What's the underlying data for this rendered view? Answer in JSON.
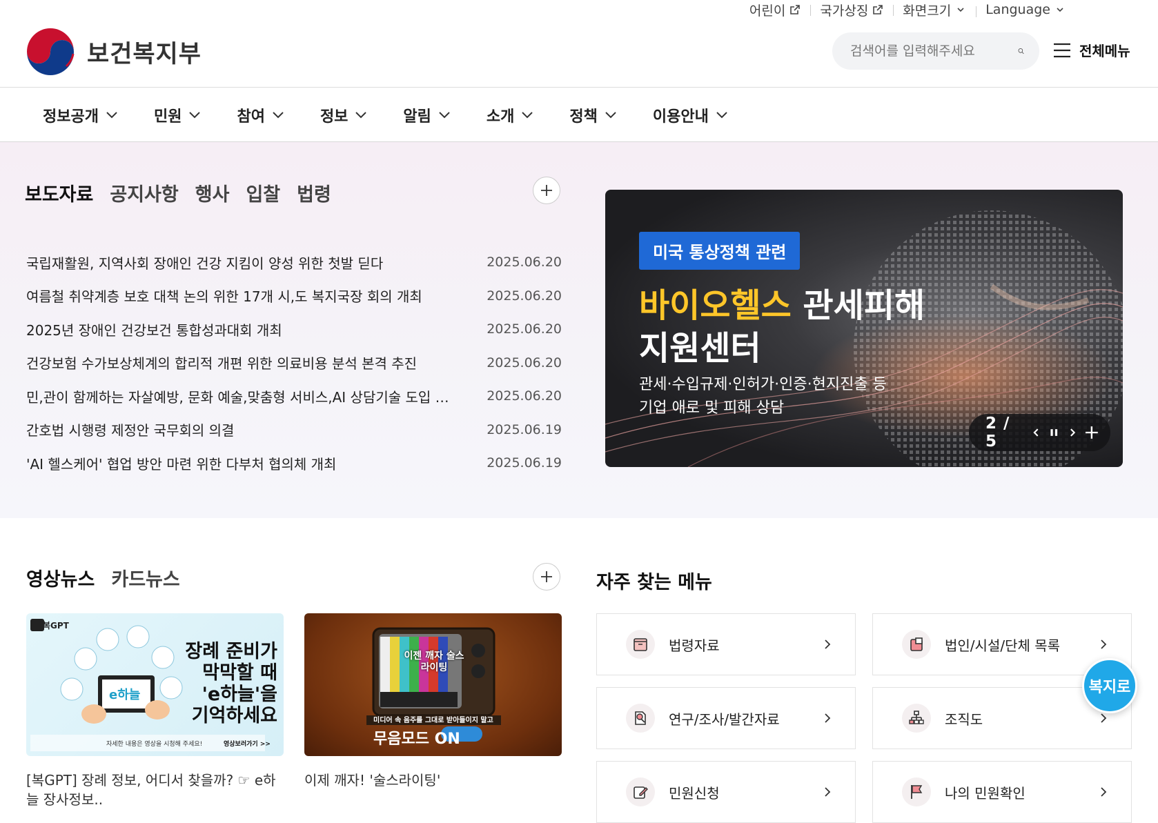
{
  "utility": {
    "kids": "어린이",
    "symbols": "국가상징",
    "font_size": "화면크기",
    "language": "Language"
  },
  "header": {
    "logo_text": "보건복지부",
    "search_placeholder": "검색어를 입력해주세요",
    "all_menu": "전체메뉴"
  },
  "nav": [
    "정보공개",
    "민원",
    "참여",
    "정보",
    "알림",
    "소개",
    "정책",
    "이용안내"
  ],
  "news": {
    "tabs": [
      "보도자료",
      "공지사항",
      "행사",
      "입찰",
      "법령"
    ],
    "items": [
      {
        "title": "국립재활원, 지역사회 장애인 건강 지킴이 양성 위한 첫발 딛다",
        "date": "2025.06.20"
      },
      {
        "title": "여름철 취약계층 보호 대책 논의 위한 17개 시,도 복지국장 회의 개최",
        "date": "2025.06.20"
      },
      {
        "title": "2025년 장애인 건강보건 통합성과대회 개최",
        "date": "2025.06.20"
      },
      {
        "title": "건강보험 수가보상체계의 합리적 개편 위한 의료비용 분석 본격 추진",
        "date": "2025.06.20"
      },
      {
        "title": "민,관이 함께하는 자살예방, 문화 예술,맞춤형 서비스,AI 상담기술 도입 등 ...",
        "date": "2025.06.20"
      },
      {
        "title": "간호법 시행령 제정안 국무회의 의결",
        "date": "2025.06.19"
      },
      {
        "title": "'AI 헬스케어' 협업 방안 마련 위한 다부처 협의체 개최",
        "date": "2025.06.19"
      }
    ]
  },
  "banner": {
    "badge": "미국 통상정책 관련",
    "title_highlight": "바이오헬스",
    "title_rest": " 관세피해",
    "title_line2": "지원센터",
    "desc_line1": "관세·수입규제·인허가·인증·현지진출 등",
    "desc_line2": "기업 애로 및 피해 상담",
    "counter": "2 / 5"
  },
  "media": {
    "tabs": [
      "영상뉴스",
      "카드뉴스"
    ],
    "videos": [
      {
        "caption": "[복GPT] 장례 정보, 어디서 찾을까? ☞ e하늘 장사정보..",
        "thumb_text": [
          "장례 준비가",
          "막막할 때",
          "'e하늘'을",
          "기억하세요"
        ],
        "thumb_footer": "자세한 내용은 영상을 시청해 주세요!",
        "thumb_more": "영상보러가기 >>",
        "thumb_logo": "복GPT",
        "thumb_brand": "e하늘"
      },
      {
        "caption": "이제 깨자! '술스라이팅'",
        "thumb_tv": "이젠 깨자 술스라이팅",
        "thumb_line1": "미디어 속 음주를 그대로 받아들이지 말고",
        "thumb_line2": "무음모드 ON"
      }
    ]
  },
  "favorites": {
    "title": "자주 찾는 메뉴",
    "items": [
      {
        "label": "법령자료",
        "icon": "law-book-icon"
      },
      {
        "label": "법인/시설/단체 목록",
        "icon": "building-icon"
      },
      {
        "label": "연구/조사/발간자료",
        "icon": "research-icon"
      },
      {
        "label": "조직도",
        "icon": "org-chart-icon"
      },
      {
        "label": "민원신청",
        "icon": "edit-form-icon"
      },
      {
        "label": "나의 민원확인",
        "icon": "flag-icon"
      }
    ]
  },
  "floating": {
    "label": "복지로"
  },
  "colors": {
    "accent_pink": "#f0a4b6",
    "badge_blue": "#1f69d6",
    "highlight_yellow": "#ffc629",
    "bokji_blue": "#20a8e8"
  }
}
